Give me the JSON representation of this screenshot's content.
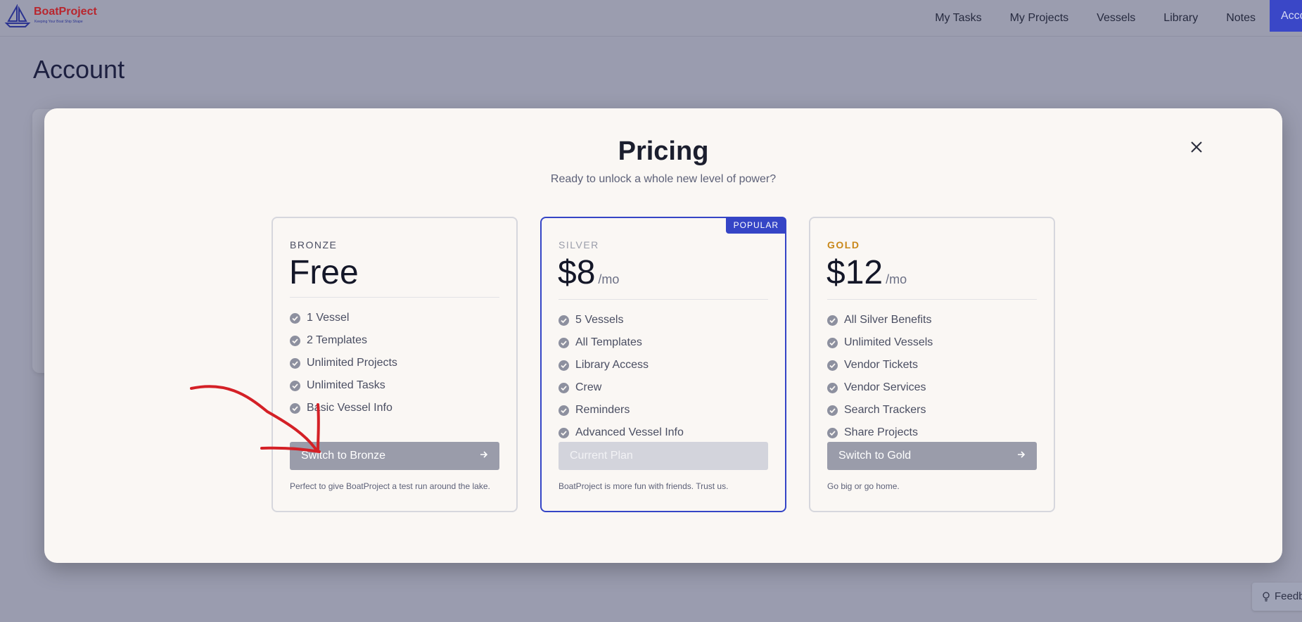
{
  "brand": {
    "name": "BoatProject",
    "tagline": "Keeping Your Boat Ship Shape"
  },
  "nav": {
    "items": [
      "My Tasks",
      "My Projects",
      "Vessels",
      "Library",
      "Notes"
    ],
    "account": "Account"
  },
  "page": {
    "title": "Account"
  },
  "modal": {
    "title": "Pricing",
    "subtitle": "Ready to unlock a whole new level of power?",
    "close": "X"
  },
  "plans": [
    {
      "name": "BRONZE",
      "price": "Free",
      "per": "",
      "features": [
        "1 Vessel",
        "2 Templates",
        "Unlimited Projects",
        "Unlimited Tasks",
        "Basic Vessel Info"
      ],
      "button": "Switch to Bronze",
      "note": "Perfect to give BoatProject a test run around the lake."
    },
    {
      "name": "SILVER",
      "price": "$8",
      "per": "/mo",
      "badge": "POPULAR",
      "features": [
        "5 Vessels",
        "All Templates",
        "Library Access",
        "Crew",
        "Reminders",
        "Advanced Vessel Info"
      ],
      "button": "Current Plan",
      "note": "BoatProject is more fun with friends. Trust us."
    },
    {
      "name": "GOLD",
      "price": "$12",
      "per": "/mo",
      "features": [
        "All Silver Benefits",
        "Unlimited Vessels",
        "Vendor Tickets",
        "Vendor Services",
        "Search Trackers",
        "Share Projects"
      ],
      "button": "Switch to Gold",
      "note": "Go big or go home."
    }
  ],
  "feedback": {
    "label": "Feedback"
  },
  "colors": {
    "accent": "#3545c6",
    "gold": "#c9881a",
    "annotation": "#d42026"
  }
}
